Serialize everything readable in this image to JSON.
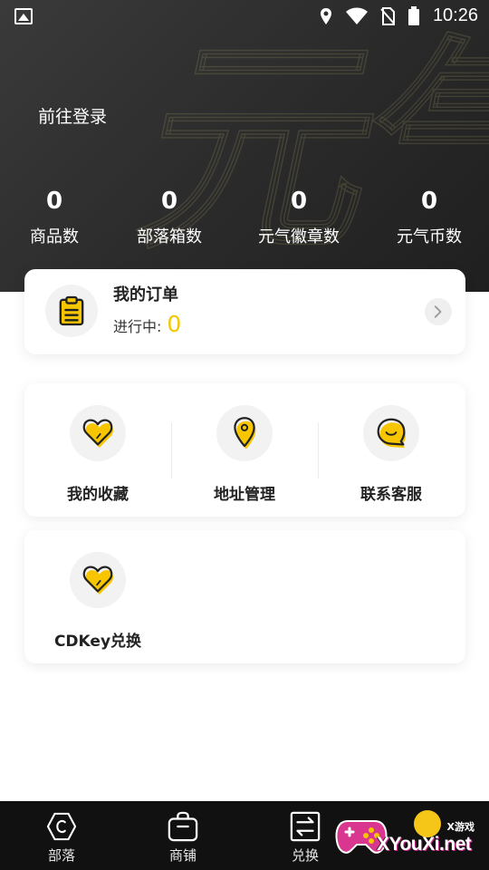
{
  "status_bar": {
    "time": "10:26"
  },
  "header": {
    "login_label": "前往登录",
    "stats": [
      {
        "value": "0",
        "label": "商品数"
      },
      {
        "value": "0",
        "label": "部落箱数"
      },
      {
        "value": "0",
        "label": "元气徽章数"
      },
      {
        "value": "0",
        "label": "元气币数"
      }
    ]
  },
  "order_card": {
    "title": "我的订单",
    "in_progress_label": "进行中:",
    "in_progress_count": "0",
    "icon": "clipboard-icon"
  },
  "services": [
    {
      "label": "我的收藏",
      "icon": "heart-icon"
    },
    {
      "label": "地址管理",
      "icon": "location-pin-icon"
    },
    {
      "label": "联系客服",
      "icon": "chat-bubble-icon"
    }
  ],
  "cdkey": {
    "label": "CDKey兑换",
    "icon": "heart-icon"
  },
  "bottom_nav": [
    {
      "label": "部落",
      "icon": "hexagon-icon"
    },
    {
      "label": "商铺",
      "icon": "shop-bag-icon"
    },
    {
      "label": "兑换",
      "icon": "exchange-icon"
    }
  ],
  "watermark": {
    "small": "X游戏",
    "text": "XYouXi.net"
  },
  "colors": {
    "accent": "#f7c600",
    "header_bg": "#2a2a2a",
    "nav_bg": "#111111"
  }
}
